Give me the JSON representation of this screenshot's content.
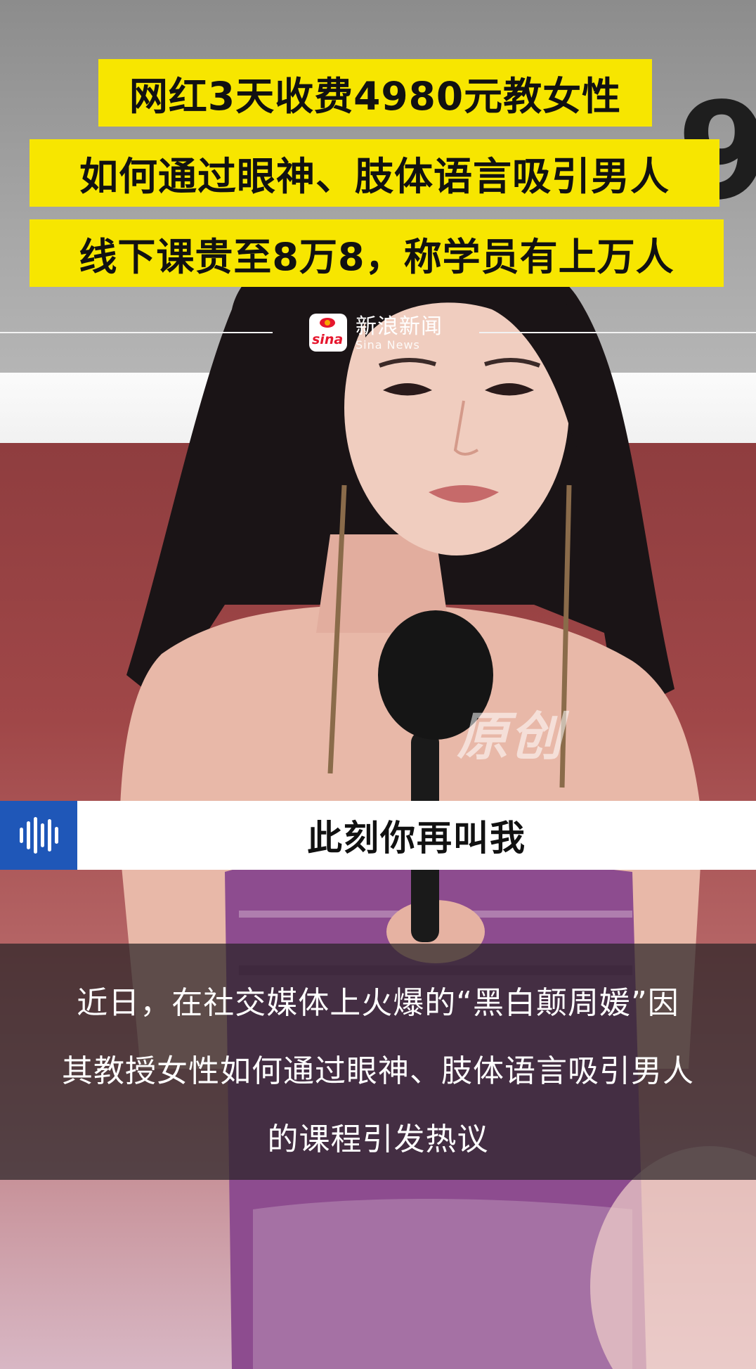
{
  "headlines": [
    "网红3天收费4980元教女性",
    "如何通过眼神、肢体语言吸引男人",
    "线下课贵至8万8，称学员有上万人"
  ],
  "source": {
    "logo_text": "sina",
    "name_zh": "新浪新闻",
    "name_en": "Sina News"
  },
  "watermark": "原创",
  "corner_glyph": "9",
  "audio": {
    "icon": "sound-wave-icon",
    "song_title": "此刻你再叫我"
  },
  "caption": {
    "lines": [
      "近日，在社交媒体上火爆的“黑白颠周媛”因",
      "其教授女性如何通过眼神、肢体语言吸引男人",
      "的课程引发热议"
    ]
  },
  "colors": {
    "headline_bg": "#f7e600",
    "audio_icon_bg": "#1f57b8",
    "sina_red": "#e6162d"
  }
}
